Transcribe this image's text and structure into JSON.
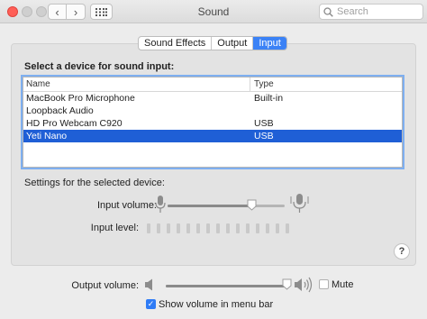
{
  "window": {
    "title": "Sound",
    "search_placeholder": "Search",
    "back_icon": "chevron-left-icon",
    "forward_icon": "chevron-right-icon",
    "grid_icon": "grid-icon"
  },
  "tabs": [
    {
      "label": "Sound Effects",
      "active": false
    },
    {
      "label": "Output",
      "active": false
    },
    {
      "label": "Input",
      "active": true
    }
  ],
  "input": {
    "section_title": "Select a device for sound input:",
    "columns": [
      "Name",
      "Type"
    ],
    "devices": [
      {
        "name": "MacBook Pro Microphone",
        "type": "Built-in",
        "selected": false
      },
      {
        "name": "Loopback Audio",
        "type": "",
        "selected": false
      },
      {
        "name": "HD Pro Webcam C920",
        "type": "USB",
        "selected": false
      },
      {
        "name": "Yeti Nano",
        "type": "USB",
        "selected": true
      }
    ],
    "settings_label": "Settings for the selected device:",
    "input_volume_label": "Input volume:",
    "input_volume_fraction": 0.72,
    "input_level_label": "Input level:",
    "input_level_segments_lit": 0,
    "help_label": "?"
  },
  "output": {
    "output_volume_label": "Output volume:",
    "output_volume_fraction": 1.0,
    "mute_label": "Mute",
    "mute_checked": false,
    "show_volume_label": "Show volume in menu bar",
    "show_volume_checked": true
  },
  "colors": {
    "accent": "#1f5fd6",
    "tab_active": "#3b82f6",
    "close_light": "#ff5f57"
  }
}
